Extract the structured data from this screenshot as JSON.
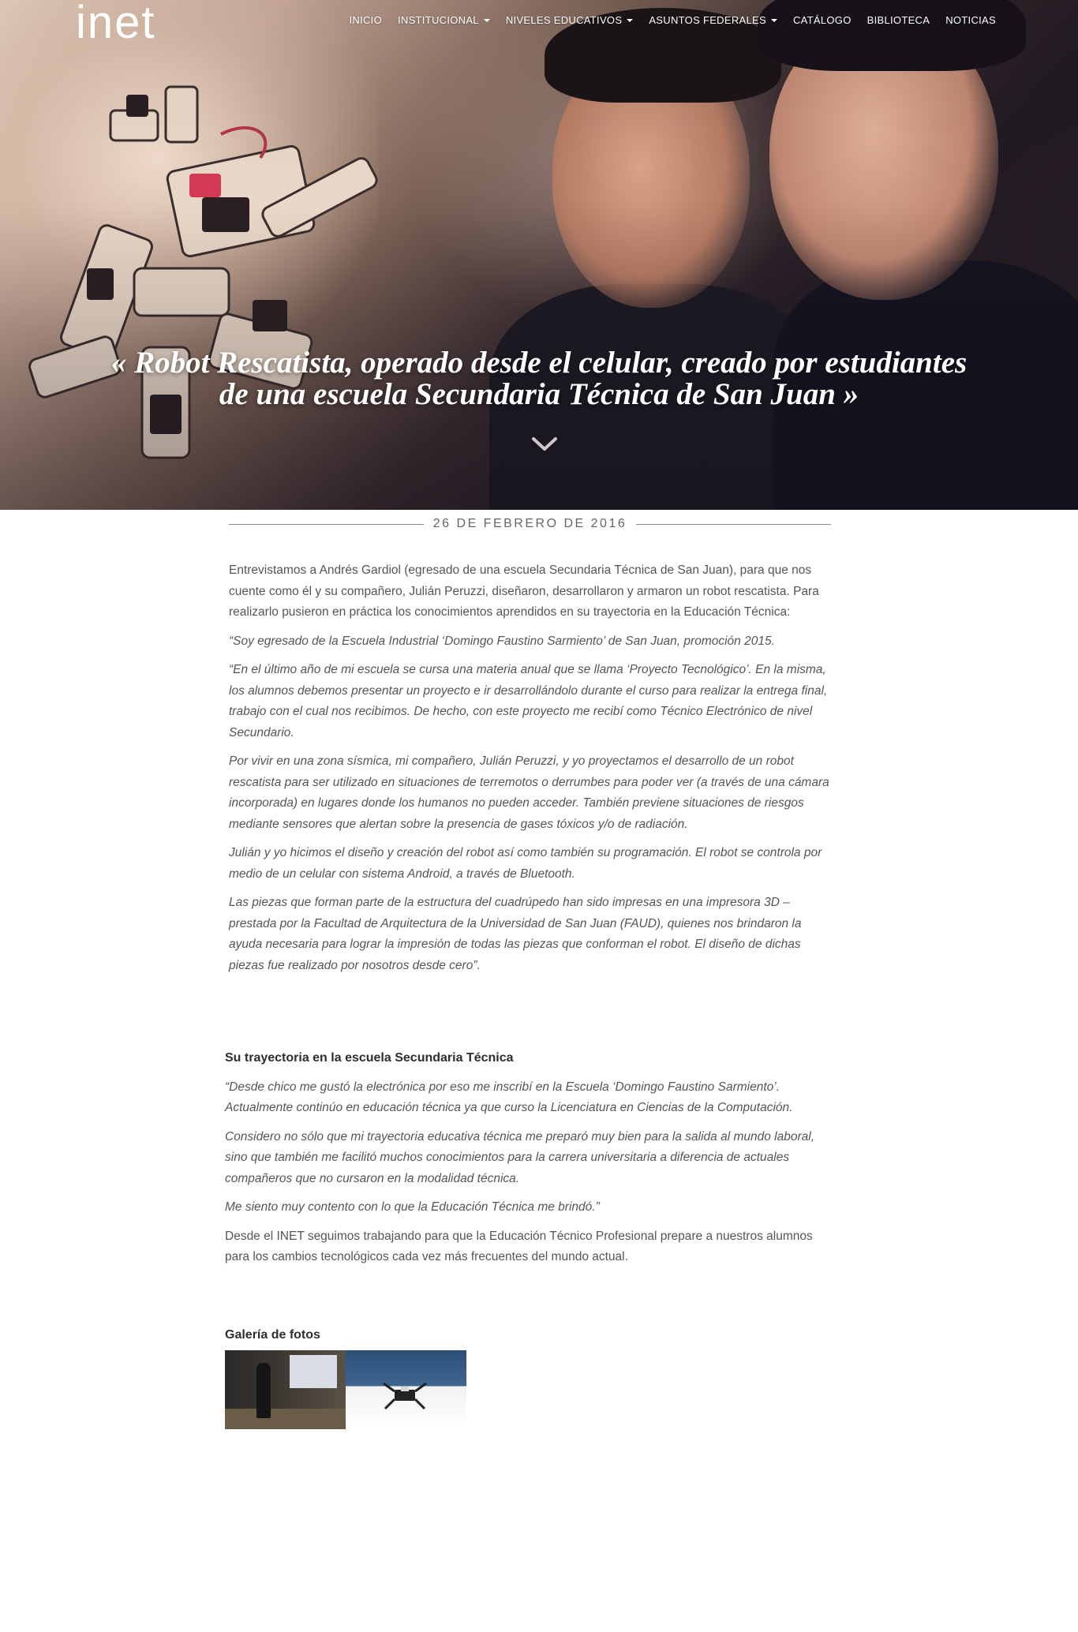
{
  "nav": {
    "logo": "inet",
    "items": [
      {
        "label": "INICIO",
        "dropdown": false
      },
      {
        "label": "INSTITUCIONAL",
        "dropdown": true
      },
      {
        "label": "NIVELES EDUCATIVOS",
        "dropdown": true
      },
      {
        "label": "ASUNTOS FEDERALES",
        "dropdown": true
      },
      {
        "label": "CATÁLOGO",
        "dropdown": false
      },
      {
        "label": "BIBLIOTECA",
        "dropdown": false
      },
      {
        "label": "NOTICIAS",
        "dropdown": false
      }
    ]
  },
  "hero": {
    "title_line1": "« Robot Rescatista, operado desde el celular, creado por estudiantes",
    "title_line2": "de una escuela Secundaria Técnica de San Juan »",
    "scroll_icon": "chevron-down-icon"
  },
  "article": {
    "date": "26 DE FEBRERO DE 2016",
    "intro": "Entrevistamos a Andrés Gardiol (egresado de una escuela Secundaria Técnica de San Juan), para que nos cuente como él y su compañero, Julián Peruzzi, diseñaron, desarrollaron y armaron un robot rescatista. Para realizarlo pusieron en práctica los conocimientos aprendidos en su trayectoria en la Educación Técnica:",
    "quotes": [
      "“Soy egresado de la Escuela Industrial ‘Domingo Faustino Sarmiento’ de San Juan, promoción 2015.",
      "“En el último año de mi escuela se cursa una materia anual que se llama ‘Proyecto Tecnológico’. En la misma, los alumnos debemos presentar un proyecto e ir desarrollándolo durante el curso para realizar la entrega final, trabajo con el cual nos recibimos. De hecho, con este proyecto me recibí como Técnico Electrónico de nivel Secundario.",
      "Por vivir en una zona sísmica, mi compañero, Julián Peruzzi, y yo proyectamos el desarrollo de un robot rescatista para ser utilizado en situaciones de terremotos o derrumbes para poder ver (a través de una cámara incorporada) en lugares donde los humanos no pueden acceder. También previene situaciones de riesgos mediante sensores que alertan sobre la presencia de gases tóxicos y/o de radiación.",
      "Julián y yo hicimos el diseño y creación del robot así como también su programación. El robot se controla por medio de un celular con sistema Android, a través de Bluetooth.",
      "Las piezas que forman parte de la estructura del cuadrúpedo han sido impresas en una impresora 3D – prestada por la Facultad de Arquitectura de la Universidad de San Juan (FAUD), quienes nos brindaron la ayuda necesaria para lograr la impresión de todas las piezas que conforman el robot. El diseño de dichas piezas fue realizado por nosotros desde cero”."
    ]
  },
  "section2": {
    "heading": "Su trayectoria en la escuela Secundaria Técnica",
    "quotes": [
      "“Desde chico me gustó la electrónica por eso me inscribí en la Escuela ‘Domingo Faustino Sarmiento’. Actualmente continúo en educación técnica ya que curso la Licenciatura en Ciencias de la Computación.",
      "Considero no sólo que mi trayectoria educativa técnica me preparó muy bien para la salida al mundo laboral, sino que también me facilitó muchos conocimientos para la carrera universitaria a diferencia de actuales compañeros que no cursaron en la modalidad técnica.",
      "Me siento muy contento con lo que la Educación Técnica me brindó.”"
    ],
    "closing": "Desde el INET seguimos trabajando para que la Educación Técnico Profesional prepare a nuestros alumnos para los cambios tecnológicos cada vez más frecuentes del mundo actual."
  },
  "gallery": {
    "heading": "Galería de fotos",
    "photos": [
      "gallery-photo-presentation",
      "gallery-photo-robot"
    ]
  },
  "colors": {
    "text": "#555555",
    "heading": "#2e2e2e",
    "rule": "#8a8a8a",
    "nav_text": "#ffffff"
  }
}
